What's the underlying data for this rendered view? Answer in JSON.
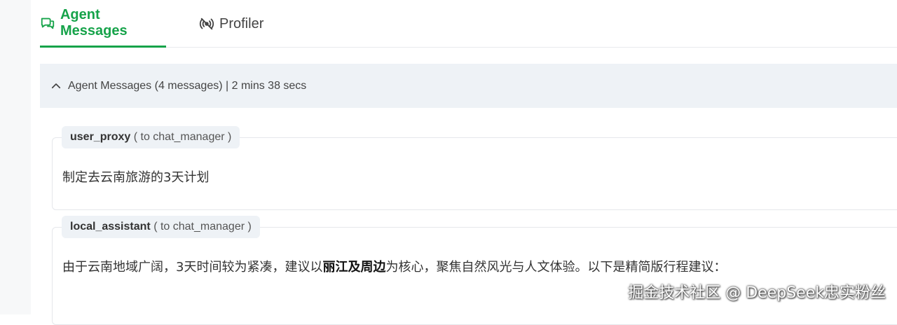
{
  "tabs": [
    {
      "label": "Agent Messages",
      "active": true,
      "icon": "chat-bubbles-icon"
    },
    {
      "label": "Profiler",
      "active": false,
      "icon": "broadcast-icon"
    }
  ],
  "panel": {
    "title": "Agent Messages (4 messages) | 2 mins 38 secs",
    "collapse_icon": "chevron-up-icon"
  },
  "messages": [
    {
      "sender": "user_proxy",
      "recipient": "( to chat_manager )",
      "text": "制定去云南旅游的3天计划"
    },
    {
      "sender": "local_assistant",
      "recipient": "( to chat_manager )",
      "text_before": "由于云南地域广阔，3天时间较为紧凑，建议以",
      "text_bold": "丽江及周边",
      "text_after": "为核心，聚焦自然风光与人文体验。以下是精简版行程建议："
    }
  ],
  "watermark": "掘金技术社区 @ DeepSeek忠实粉丝",
  "colors": {
    "accent": "#16a34a",
    "panel_bg": "#eef2f6"
  }
}
